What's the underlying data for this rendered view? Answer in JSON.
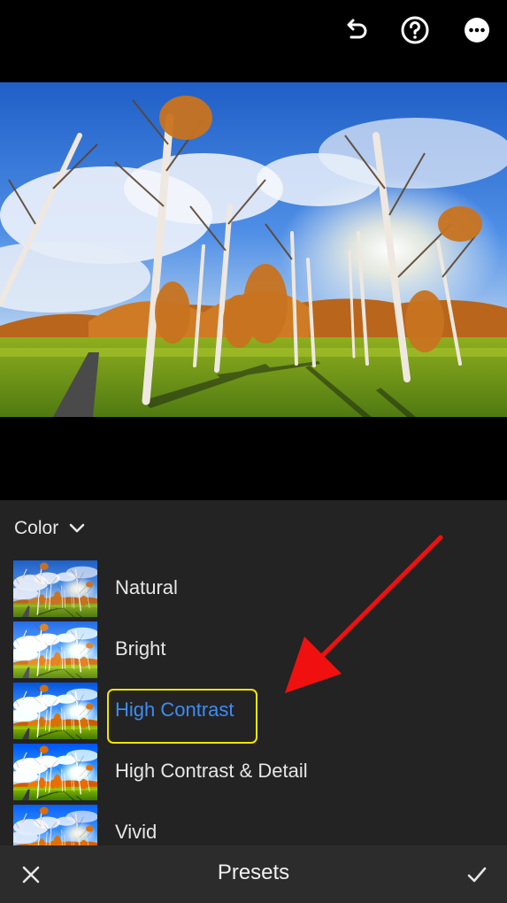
{
  "toolbar": {
    "icons": [
      "undo-icon",
      "help-icon",
      "more-icon"
    ]
  },
  "presets_panel": {
    "group_label": "Color",
    "items": [
      {
        "label": "Natural",
        "selected": false
      },
      {
        "label": "Bright",
        "selected": false
      },
      {
        "label": "High Contrast",
        "selected": true
      },
      {
        "label": "High Contrast & Detail",
        "selected": false
      },
      {
        "label": "Vivid",
        "selected": false
      }
    ]
  },
  "bottom_bar": {
    "title": "Presets",
    "cancel_icon": "close-icon",
    "confirm_icon": "checkmark-icon"
  },
  "colors": {
    "selected_text": "#3d8cf5",
    "highlight_box": "#f2e600",
    "annotation_arrow": "#f01010",
    "panel_bg": "#232323"
  }
}
